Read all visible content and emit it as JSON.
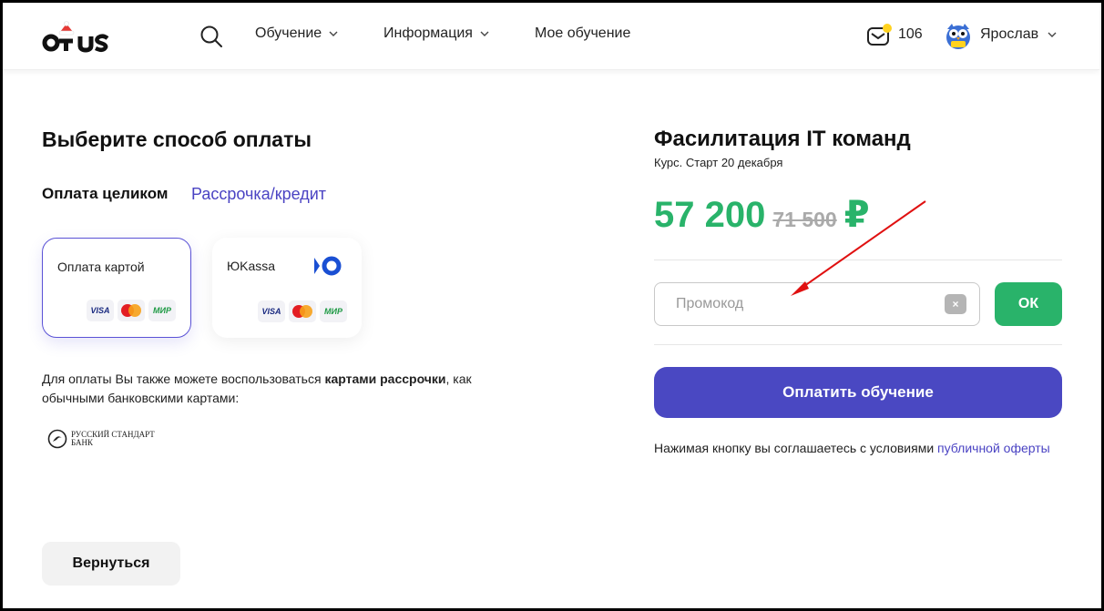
{
  "header": {
    "logo_text": "otus",
    "nav": [
      {
        "label": "Обучение"
      },
      {
        "label": "Информация"
      },
      {
        "label": "Мое обучение"
      }
    ],
    "mail_count": "106",
    "user_name": "Ярослав"
  },
  "left": {
    "title": "Выберите способ оплаты",
    "tab_full": "Оплата целиком",
    "tab_installment": "Рассрочка/кредит",
    "methods": [
      {
        "label": "Оплата картой",
        "badges": [
          "VISA",
          "mastercard",
          "МИР"
        ]
      },
      {
        "label": "ЮKassa",
        "badges": [
          "VISA",
          "mastercard",
          "МИР"
        ]
      }
    ],
    "note_pre": "Для оплаты Вы также можете воспользоваться ",
    "note_bold": "картами рассрочки",
    "note_post": ", как обычными банковскими картами:",
    "bank_line1": "РУССКИЙ СТАНДАРТ",
    "bank_line2": "БАНК",
    "back_button": "Вернуться"
  },
  "right": {
    "course_title": "Фасилитация IT команд",
    "course_subtitle": "Курс. Старт 20 декабря",
    "price_new": "57 200",
    "price_old": "71 500",
    "currency": "₽",
    "promo_placeholder": "Промокод",
    "promo_clear": "×",
    "ok_button": "ОК",
    "pay_button": "Оплатить обучение",
    "agree_text": "Нажимая кнопку вы соглашаетесь с условиями ",
    "agree_link": "публичной оферты"
  },
  "colors": {
    "accent": "#4a48c2",
    "price_green": "#29b36a",
    "annotation_arrow": "#e01010"
  }
}
